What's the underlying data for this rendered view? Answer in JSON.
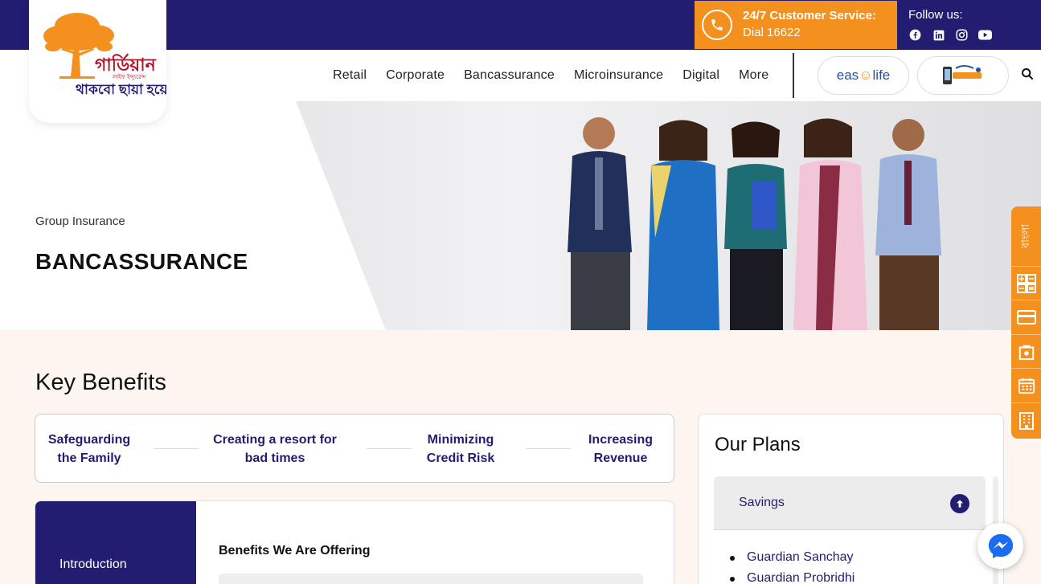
{
  "brand": {
    "logo_name": "গার্ডিয়ান",
    "logo_sub": "লাইফ ইন্স্যুরেন্স",
    "logo_tagline": "থাকবো ছায়া হয়ে"
  },
  "topbar": {
    "customer_service_title": "24/7 Customer Service:",
    "customer_service_dial": "Dial 16622",
    "follow_label": "Follow us:",
    "social": [
      "facebook-icon",
      "linkedin-icon",
      "instagram-icon",
      "youtube-icon"
    ]
  },
  "nav": {
    "items": [
      "Retail",
      "Corporate",
      "Bancassurance",
      "Microinsurance",
      "Digital",
      "More"
    ],
    "easylife_label_a": "eas",
    "easylife_label_b": "life"
  },
  "hero": {
    "subtitle": "Group Insurance",
    "title": "BANCASSURANCE"
  },
  "key_benefits": {
    "title": "Key Benefits",
    "items": [
      {
        "line1": "Safeguarding",
        "line2": "the Family"
      },
      {
        "line1": "Creating a resort for",
        "line2": "bad times"
      },
      {
        "line1": "Minimizing",
        "line2": "Credit Risk"
      },
      {
        "line1": "Increasing",
        "line2": "Revenue"
      }
    ]
  },
  "introduction": {
    "tab_label": "Introduction",
    "offer_title": "Benefits We Are Offering"
  },
  "plans": {
    "title": "Our Plans",
    "category": "Savings",
    "items": [
      "Guardian Sanchay",
      "Guardian Probridhi"
    ]
  },
  "sticky": {
    "language_label": "বাংলা",
    "icons": [
      "calculator-icon",
      "card-icon",
      "bag-icon",
      "calendar-icon",
      "building-icon"
    ]
  },
  "colors": {
    "navy": "#231d72",
    "orange": "#f4901e"
  }
}
